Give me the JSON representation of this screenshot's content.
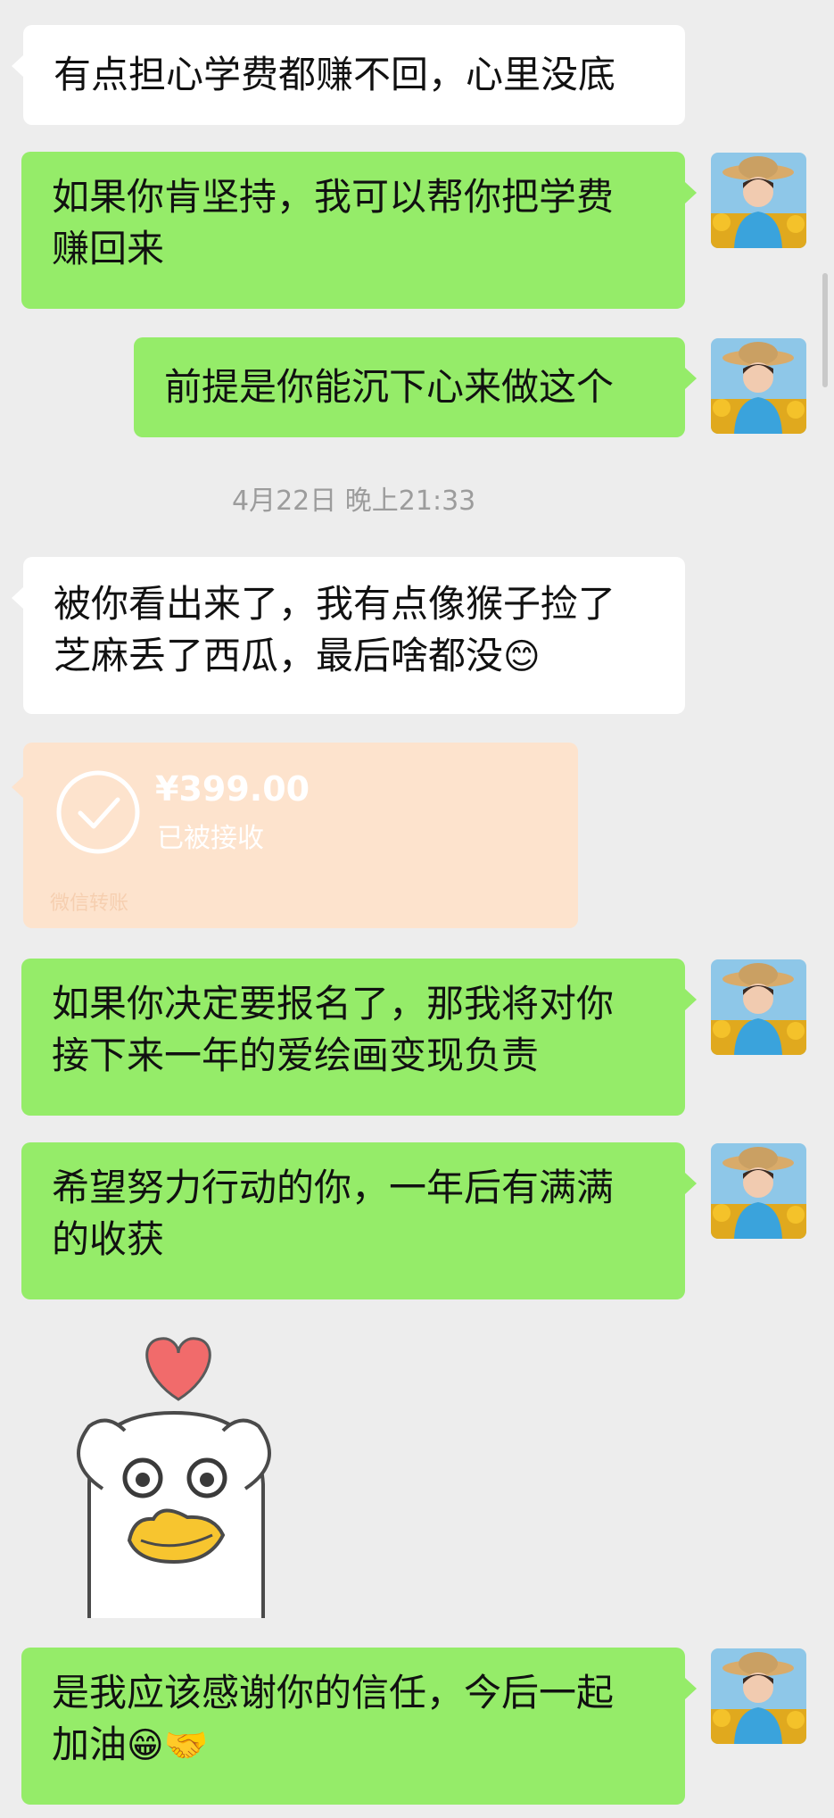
{
  "messages": [
    {
      "from": "contact",
      "text": "有点担心学费都赚不回，心里没底"
    },
    {
      "from": "me",
      "line1": "如果你肯坚持，我可以帮你把学费",
      "line2": "赚回来"
    },
    {
      "from": "me",
      "text": "前提是你能沉下心来做这个"
    },
    {
      "from": "contact",
      "line1": "被你看出来了，我有点像猴子捡了",
      "line2": "芝麻丢了西瓜，最后啥都没",
      "emoji": "😊"
    },
    {
      "from": "me",
      "line1": "如果你决定要报名了，那我将对你",
      "line2": "接下来一年的爱绘画变现负责"
    },
    {
      "from": "me",
      "line1": "希望努力行动的你，一年后有满满",
      "line2": "的收获"
    },
    {
      "from": "me",
      "line1": "是我应该感谢你的信任，今后一起",
      "line2": "加油",
      "emoji": "😁🤝"
    }
  ],
  "timestamp": "4月22日 晚上21:33",
  "transfer": {
    "amount": "¥399.00",
    "status": "已被接收",
    "footer": "微信转账"
  },
  "sticker": {
    "icon": "duck-heart-sticker-icon"
  },
  "colors": {
    "me_bubble": "#95ec69",
    "contact_bubble": "#ffffff",
    "background": "#ededed",
    "transfer": "#fde3cd"
  }
}
